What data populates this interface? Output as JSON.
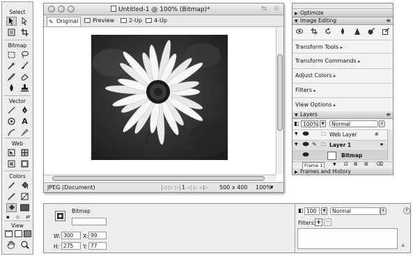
{
  "tools": {
    "sections": {
      "select": "Select",
      "bitmap": "Bitmap",
      "vector": "Vector",
      "web": "Web",
      "colors": "Colors",
      "view": "View"
    },
    "icons": {
      "select": [
        "pointer-icon",
        "subselect-icon",
        "scale-icon",
        "crop-icon"
      ],
      "bitmap": [
        "marquee-icon",
        "lasso-icon",
        "magic-wand-icon",
        "brush-icon",
        "pencil-icon",
        "eraser-icon",
        "blur-icon",
        "rubber-stamp-icon"
      ],
      "vector": [
        "line-icon",
        "pen-icon",
        "ellipse-icon",
        "text-icon",
        "freeform-icon",
        "knife-icon"
      ],
      "web": [
        "hotspot-icon",
        "slice-icon",
        "hide-slices-icon",
        "show-slices-icon"
      ],
      "colors": [
        "stroke-color-icon",
        "fill-color-icon",
        "stroke-swatch-icon",
        "fill-swatch-icon"
      ],
      "view": [
        "standard-mode-icon",
        "fullscreen-menu-icon",
        "fullscreen-icon",
        "hand-icon",
        "zoom-icon"
      ]
    }
  },
  "document": {
    "title": "Untitled-1 @ 100% (Bitmap)*",
    "tabs": [
      "Original",
      "Preview",
      "2-Up",
      "4-Up"
    ],
    "active_tab": "Original",
    "status": {
      "format": "JPEG (Document)",
      "frame": "1",
      "size": "500 x 400",
      "zoom": "100%"
    }
  },
  "panels": {
    "optimize": "Optimize",
    "image_editing": "Image Editing",
    "ie_icons": [
      "eye-icon",
      "crop-icon",
      "rotate-icon",
      "dropper-icon",
      "sharpen-icon",
      "blur-icon",
      "gradient-icon"
    ],
    "items": [
      "Transform Tools",
      "Transform Commands",
      "Adjust Colors",
      "Filters",
      "View Options"
    ],
    "layers": {
      "title": "Layers",
      "opacity": "100%",
      "blend": "Normal",
      "rows": [
        {
          "name": "Web Layer",
          "bold": false
        },
        {
          "name": "Layer 1",
          "bold": true
        },
        {
          "name": "Bitmap",
          "bold": true
        }
      ],
      "frame": "Frame 1"
    },
    "frames_history": "Frames and History"
  },
  "properties": {
    "object_type": "Bitmap",
    "object_name": "",
    "w": "300",
    "x": "99",
    "h": "275",
    "y": "77",
    "opacity": "100",
    "blend": "Normal",
    "filters_label": "Filters:",
    "add_label": "+",
    "remove_label": "−",
    "help_label": "?"
  }
}
